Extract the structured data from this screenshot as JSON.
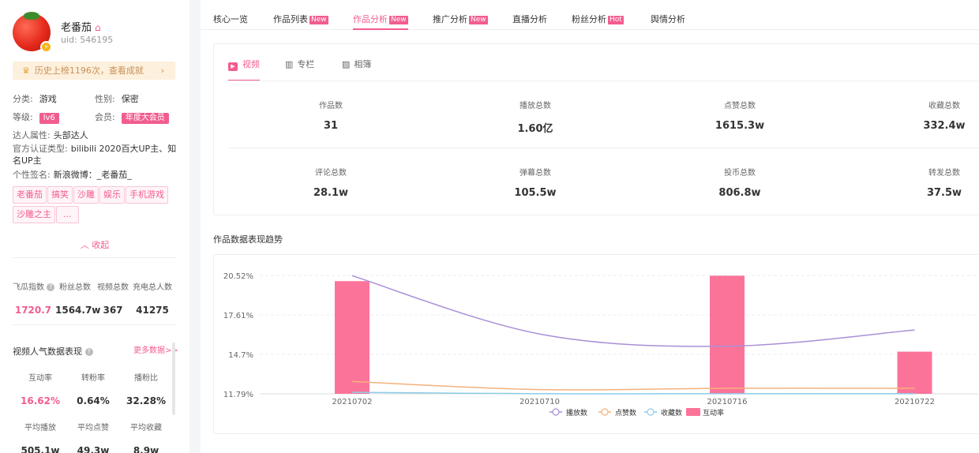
{
  "profile": {
    "name": "老番茄",
    "uid": "uid: 546195",
    "rank_text": "历史上榜1196次，查看成就",
    "category_label": "分类:",
    "category": "游戏",
    "gender_label": "性别:",
    "gender": "保密",
    "level_label": "等级:",
    "level": "lv6",
    "member_label": "会员:",
    "member": "年度大会员",
    "talent_label": "达人属性:",
    "talent": "头部达人",
    "cert_label": "官方认证类型:",
    "cert": "bilibili 2020百大UP主、知名UP主",
    "sign_label": "个性签名:",
    "sign": "新浪微博：_老番茄_",
    "tags": [
      "老番茄",
      "搞笑",
      "沙雕",
      "娱乐",
      "手机游戏",
      "沙雕之主",
      "..."
    ],
    "collapse": "收起"
  },
  "left_stats": [
    {
      "label": "飞瓜指数",
      "value": "1720.7"
    },
    {
      "label": "粉丝总数",
      "value": "1564.7w"
    },
    {
      "label": "视频总数",
      "value": "367"
    },
    {
      "label": "充电总人数",
      "value": "41275"
    }
  ],
  "popularity": {
    "title": "视频人气数据表现",
    "more": "更多数据>>",
    "row1": [
      {
        "label": "互动率",
        "value": "16.62%"
      },
      {
        "label": "转粉率",
        "value": "0.64%"
      },
      {
        "label": "播粉比",
        "value": "32.28%"
      }
    ],
    "row2": [
      {
        "label": "平均播放",
        "value": "505.1w"
      },
      {
        "label": "平均点赞",
        "value": "49.3w"
      },
      {
        "label": "平均收藏",
        "value": "8.9w"
      }
    ]
  },
  "nav": {
    "tabs": [
      "核心一览",
      "作品列表",
      "作品分析",
      "推广分析",
      "直播分析",
      "粉丝分析",
      "舆情分析"
    ],
    "badges": {
      "new": "New",
      "hot": "Hot"
    }
  },
  "subtabs": [
    "视频",
    "专栏",
    "相簿"
  ],
  "metrics": [
    {
      "label": "作品数",
      "value": "31"
    },
    {
      "label": "播放总数",
      "value": "1.60亿"
    },
    {
      "label": "点赞总数",
      "value": "1615.3w"
    },
    {
      "label": "收藏总数",
      "value": "332.4w"
    },
    {
      "label": "评论总数",
      "value": "28.1w"
    },
    {
      "label": "弹幕总数",
      "value": "105.5w"
    },
    {
      "label": "投币总数",
      "value": "806.8w"
    },
    {
      "label": "转发总数",
      "value": "37.5w"
    }
  ],
  "trend_title": "作品数据表现趋势",
  "colors": {
    "accent": "#f25d8e",
    "bar": "#fc7399",
    "play": "#a98fd6",
    "like": "#f6b27c",
    "fav": "#8ccbe8"
  },
  "chart_data": {
    "type": "bar",
    "categories": [
      "20210702",
      "20210710",
      "20210716",
      "20210722"
    ],
    "x_positions": [
      "20210702",
      "20210716",
      "20210722"
    ],
    "y_ticks": [
      "20.52%",
      "17.61%",
      "14.7%",
      "11.79%"
    ],
    "ylim": [
      11.79,
      20.52
    ],
    "series": [
      {
        "name": "互动率",
        "type": "bar",
        "values": [
          20.1,
          20.5,
          14.9
        ]
      },
      {
        "name": "播放数",
        "type": "line",
        "values": [
          20.5,
          16.2,
          15.3,
          16.5
        ]
      },
      {
        "name": "点赞数",
        "type": "line",
        "values": [
          12.7,
          12.1,
          12.2,
          12.2
        ]
      },
      {
        "name": "收藏数",
        "type": "line",
        "values": [
          11.9,
          11.8,
          11.8,
          11.8
        ]
      }
    ],
    "legend": [
      "播放数",
      "点赞数",
      "收藏数",
      "互动率"
    ]
  }
}
